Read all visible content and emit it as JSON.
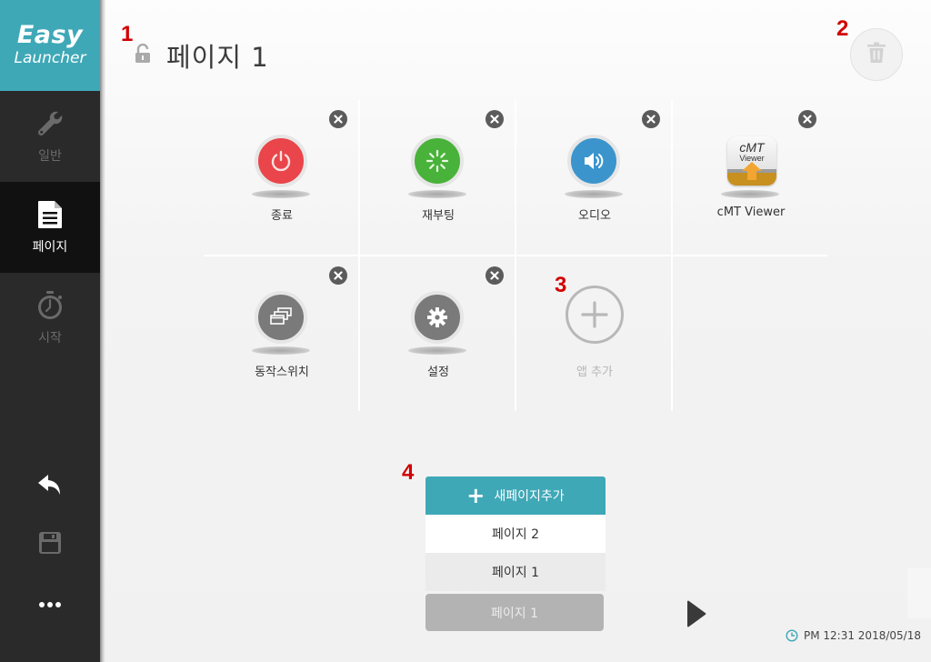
{
  "sidebar": {
    "logo_line1": "Easy",
    "logo_line2": "Launcher",
    "items": [
      {
        "label": "일반",
        "icon": "wrench-icon",
        "active": false
      },
      {
        "label": "페이지",
        "icon": "document-icon",
        "active": true
      },
      {
        "label": "시작",
        "icon": "stopwatch-icon",
        "active": false
      }
    ],
    "bottom_buttons": [
      "back-arrow-icon",
      "save-icon",
      "more-icon"
    ]
  },
  "markers": [
    "1",
    "2",
    "3",
    "4"
  ],
  "header": {
    "title": "페이지 1",
    "lock_icon": "unlocked-icon",
    "delete_icon": "trash-icon"
  },
  "apps": [
    {
      "label": "종료",
      "icon": "power-icon",
      "color": "#e9454a"
    },
    {
      "label": "재부팅",
      "icon": "reboot-icon",
      "color": "#49b23a"
    },
    {
      "label": "오디오",
      "icon": "speaker-icon",
      "color": "#3b95cc"
    },
    {
      "label": "cMT Viewer",
      "icon": "cmt-viewer-icon",
      "icon_text1": "cMT",
      "icon_text2": "Viewer"
    },
    {
      "label": "동작스위치",
      "icon": "windows-switch-icon",
      "color": "#7a7a7a"
    },
    {
      "label": "설정",
      "icon": "gear-icon",
      "color": "#7a7a7a"
    }
  ],
  "add_app": {
    "label": "앱 추가"
  },
  "page_menu": {
    "add_label": "새페이지추가",
    "options": [
      "페이지 2",
      "페이지 1"
    ],
    "current": "페이지 1"
  },
  "status": {
    "clock": "PM 12:31 2018/05/18"
  },
  "colors": {
    "accent": "#3fa8b7",
    "sidebar_bg": "#2a2a2a",
    "sidebar_active": "#111111",
    "marker": "#d10000"
  }
}
